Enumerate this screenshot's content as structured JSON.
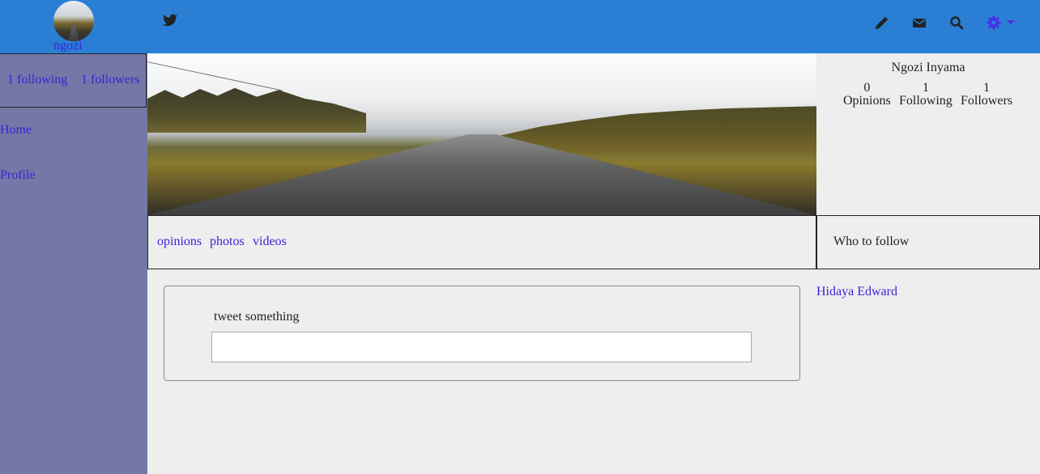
{
  "navbar": {
    "username": "ngozi",
    "colors": {
      "background": "#2a7fd4",
      "icon": "#222222",
      "accent": "#4a2ee8"
    },
    "icons": [
      "twitter-icon",
      "pencil-icon",
      "envelope-icon",
      "search-icon",
      "gear-icon",
      "caret-down-icon"
    ]
  },
  "sidebar": {
    "following": "1 following",
    "followers": "1 followers",
    "links": {
      "home": "Home",
      "profile": "Profile"
    },
    "color": "#7378a6"
  },
  "profile": {
    "name": "Ngozi Inyama",
    "stats": [
      {
        "value": "0",
        "label": "Opinions"
      },
      {
        "value": "1",
        "label": "Following"
      },
      {
        "value": "1",
        "label": "Followers"
      }
    ]
  },
  "tabs": {
    "opinions": "opinions",
    "photos": "photos",
    "videos": "videos"
  },
  "who_to_follow": {
    "title": "Who to follow",
    "users": [
      "Hidaya Edward"
    ]
  },
  "compose": {
    "label": "tweet something",
    "value": ""
  }
}
